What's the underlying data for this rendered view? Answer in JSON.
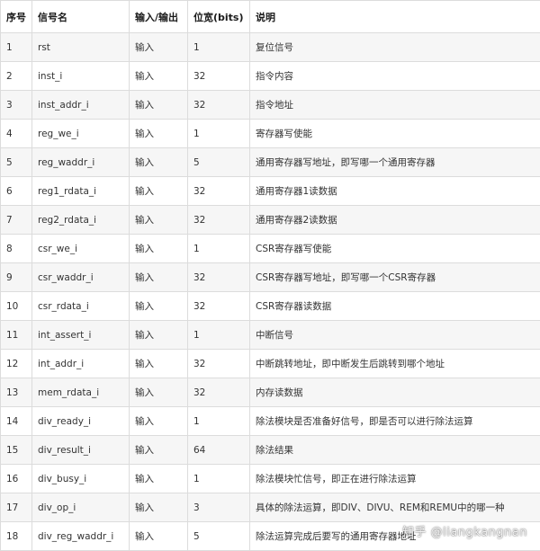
{
  "table": {
    "headers": [
      "序号",
      "信号名",
      "输入/输出",
      "位宽(bits)",
      "说明"
    ],
    "rows": [
      [
        "1",
        "rst",
        "输入",
        "1",
        "复位信号"
      ],
      [
        "2",
        "inst_i",
        "输入",
        "32",
        "指令内容"
      ],
      [
        "3",
        "inst_addr_i",
        "输入",
        "32",
        "指令地址"
      ],
      [
        "4",
        "reg_we_i",
        "输入",
        "1",
        "寄存器写使能"
      ],
      [
        "5",
        "reg_waddr_i",
        "输入",
        "5",
        "通用寄存器写地址，即写哪一个通用寄存器"
      ],
      [
        "6",
        "reg1_rdata_i",
        "输入",
        "32",
        "通用寄存器1读数据"
      ],
      [
        "7",
        "reg2_rdata_i",
        "输入",
        "32",
        "通用寄存器2读数据"
      ],
      [
        "8",
        "csr_we_i",
        "输入",
        "1",
        "CSR寄存器写使能"
      ],
      [
        "9",
        "csr_waddr_i",
        "输入",
        "32",
        "CSR寄存器写地址，即写哪一个CSR寄存器"
      ],
      [
        "10",
        "csr_rdata_i",
        "输入",
        "32",
        "CSR寄存器读数据"
      ],
      [
        "11",
        "int_assert_i",
        "输入",
        "1",
        "中断信号"
      ],
      [
        "12",
        "int_addr_i",
        "输入",
        "32",
        "中断跳转地址，即中断发生后跳转到哪个地址"
      ],
      [
        "13",
        "mem_rdata_i",
        "输入",
        "32",
        "内存读数据"
      ],
      [
        "14",
        "div_ready_i",
        "输入",
        "1",
        "除法模块是否准备好信号，即是否可以进行除法运算"
      ],
      [
        "15",
        "div_result_i",
        "输入",
        "64",
        "除法结果"
      ],
      [
        "16",
        "div_busy_i",
        "输入",
        "1",
        "除法模块忙信号，即正在进行除法运算"
      ],
      [
        "17",
        "div_op_i",
        "输入",
        "3",
        "具体的除法运算，即DIV、DIVU、REM和REMU中的哪一种"
      ],
      [
        "18",
        "div_reg_waddr_i",
        "输入",
        "5",
        "除法运算完成后要写的通用寄存器地址"
      ]
    ]
  },
  "watermark": {
    "text": "知乎 @liangkangnan"
  }
}
